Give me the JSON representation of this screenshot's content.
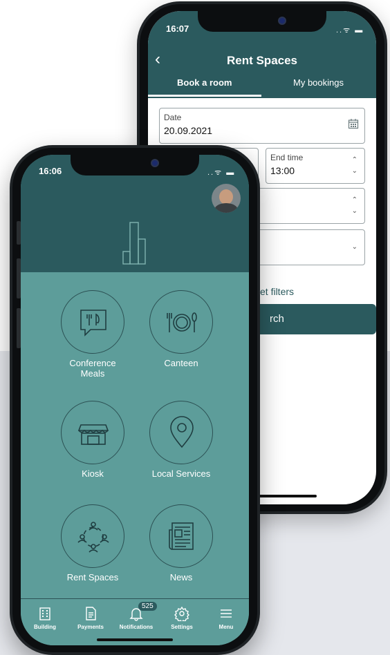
{
  "back_phone": {
    "status": {
      "time": "16:07",
      "icons": "..ᯤ ▬"
    },
    "header": {
      "title": "Rent Spaces",
      "back_icon": "chevron-left-icon"
    },
    "tabs": [
      {
        "label": "Book a room",
        "active": true
      },
      {
        "label": "My bookings",
        "active": false
      }
    ],
    "form": {
      "date": {
        "label": "Date",
        "value": "20.09.2021",
        "icon": "calendar-icon"
      },
      "end_time": {
        "label": "End time",
        "value": "13:00"
      },
      "reset_filters": "et filters",
      "search_button": "rch"
    }
  },
  "front_phone": {
    "status": {
      "time": "16:06",
      "icons": "..ᯤ ▬"
    },
    "tiles": [
      {
        "label": "Conference\nMeals",
        "icon": "conference-meals-icon"
      },
      {
        "label": "Canteen",
        "icon": "canteen-icon"
      },
      {
        "label": "Kiosk",
        "icon": "kiosk-icon"
      },
      {
        "label": "Local Services",
        "icon": "location-pin-icon"
      },
      {
        "label": "Rent Spaces",
        "icon": "rent-spaces-icon"
      },
      {
        "label": "News",
        "icon": "news-icon"
      }
    ],
    "nav": [
      {
        "label": "Building",
        "icon": "building-icon"
      },
      {
        "label": "Payments",
        "icon": "document-icon"
      },
      {
        "label": "Notifications",
        "icon": "bell-icon",
        "badge": "525"
      },
      {
        "label": "Settings",
        "icon": "gear-icon"
      },
      {
        "label": "Menu",
        "icon": "hamburger-icon"
      }
    ]
  },
  "colors": {
    "primary": "#2b5a5e",
    "teal": "#5d9d9a",
    "background": "#e5e7ec"
  }
}
